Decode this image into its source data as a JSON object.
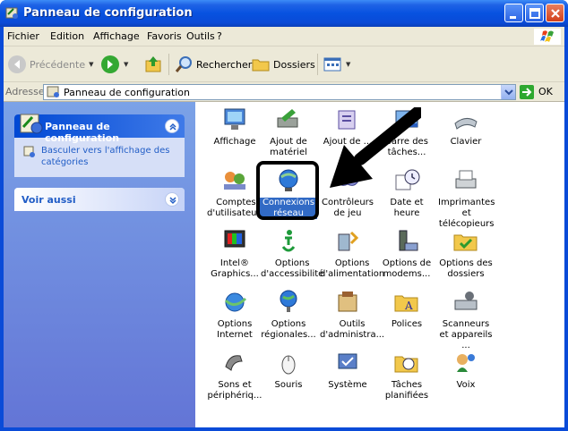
{
  "window": {
    "title": "Panneau de configuration"
  },
  "menu": [
    "Fichier",
    "Edition",
    "Affichage",
    "Favoris",
    "Outils",
    "?"
  ],
  "toolbar": {
    "back_label": "Précédente",
    "search_label": "Rechercher",
    "folders_label": "Dossiers"
  },
  "address": {
    "label": "Adresse",
    "value": "Panneau de configuration",
    "go_label": "OK"
  },
  "taskpane": {
    "primary_title": "Panneau de configuration",
    "switch_view_link": "Basculer vers l'affichage des catégories",
    "see_also_title": "Voir aussi"
  },
  "items": [
    {
      "label": "Affichage",
      "icon": "display-icon"
    },
    {
      "label": "Ajout de matériel",
      "icon": "add-hardware-icon"
    },
    {
      "label": "Ajout de ...",
      "icon": "add-remove-programs-icon"
    },
    {
      "label": "Barre des tâches...",
      "icon": "taskbar-icon"
    },
    {
      "label": "Clavier",
      "icon": "keyboard-icon"
    },
    {
      "label": "Comptes d'utilisateurs",
      "icon": "user-accounts-icon"
    },
    {
      "label": "Connexions réseau",
      "icon": "network-connections-icon"
    },
    {
      "label": "Contrôleurs de jeu",
      "icon": "game-controllers-icon"
    },
    {
      "label": "Date et heure",
      "icon": "date-time-icon"
    },
    {
      "label": "Imprimantes et télécopieurs",
      "icon": "printers-faxes-icon"
    },
    {
      "label": "Intel® Graphics...",
      "icon": "intel-graphics-icon"
    },
    {
      "label": "Options d'accessibilité",
      "icon": "accessibility-icon"
    },
    {
      "label": "Options d'alimentation",
      "icon": "power-options-icon"
    },
    {
      "label": "Options de modems...",
      "icon": "phone-modem-icon"
    },
    {
      "label": "Options des dossiers",
      "icon": "folder-options-icon"
    },
    {
      "label": "Options Internet",
      "icon": "internet-options-icon"
    },
    {
      "label": "Options régionales...",
      "icon": "regional-options-icon"
    },
    {
      "label": "Outils d'administra...",
      "icon": "admin-tools-icon"
    },
    {
      "label": "Polices",
      "icon": "fonts-icon"
    },
    {
      "label": "Scanneurs et appareils ...",
      "icon": "scanners-cameras-icon"
    },
    {
      "label": "Sons et périphériq...",
      "icon": "sounds-icon"
    },
    {
      "label": "Souris",
      "icon": "mouse-icon"
    },
    {
      "label": "Système",
      "icon": "system-icon"
    },
    {
      "label": "Tâches planifiées",
      "icon": "scheduled-tasks-icon"
    },
    {
      "label": "Voix",
      "icon": "speech-icon"
    }
  ],
  "selected_item": "Connexions réseau",
  "colors": {
    "titlebar": "#0752e0",
    "selection": "#316ac5",
    "taskpane": "#6375d6",
    "link": "#215dc6"
  }
}
